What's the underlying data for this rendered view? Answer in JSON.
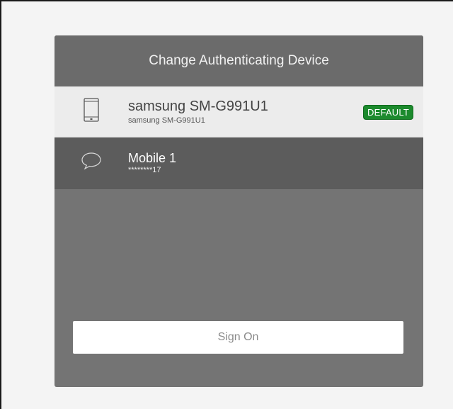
{
  "dialog": {
    "title": "Change Authenticating Device"
  },
  "devices": [
    {
      "name": "samsung SM-G991U1",
      "detail": "samsung SM-G991U1",
      "badge": "DEFAULT",
      "icon": "smartphone-icon",
      "selected": true
    },
    {
      "name": "Mobile 1",
      "detail": "********17",
      "icon": "chat-bubble-icon",
      "selected": false
    }
  ],
  "actions": {
    "sign_on_label": "Sign On"
  },
  "colors": {
    "panel": "#747474",
    "header": "#6b6b6b",
    "selected_row": "#ececec",
    "other_row": "#5c5c5c",
    "badge": "#1c8a2d"
  }
}
